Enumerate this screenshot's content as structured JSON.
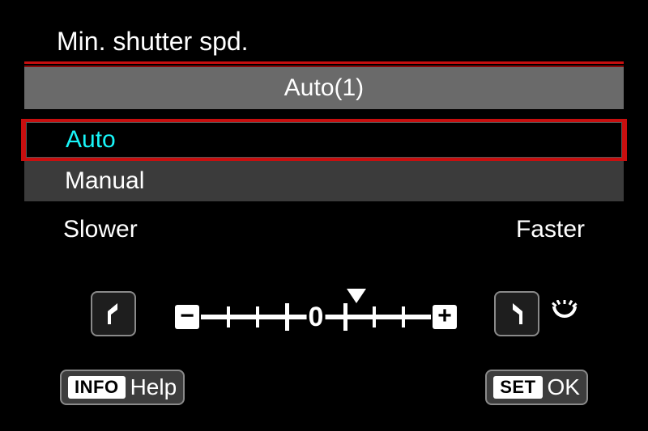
{
  "title": "Min. shutter spd.",
  "current_value": "Auto(1)",
  "options": {
    "auto": "Auto",
    "manual": "Manual"
  },
  "selected_option": "auto",
  "scale": {
    "left_label": "Slower",
    "right_label": "Faster",
    "min": -3,
    "max": 3,
    "center": 0,
    "center_label": "0",
    "minus_label": "−",
    "plus_label": "+",
    "marker_position": 1
  },
  "footer": {
    "info_tag": "INFO",
    "info_label": "Help",
    "set_tag": "SET",
    "set_label": "OK"
  },
  "icons": {
    "return_left": "return-arrow-left",
    "return_right": "return-arrow-right",
    "dial": "dial-gear"
  }
}
